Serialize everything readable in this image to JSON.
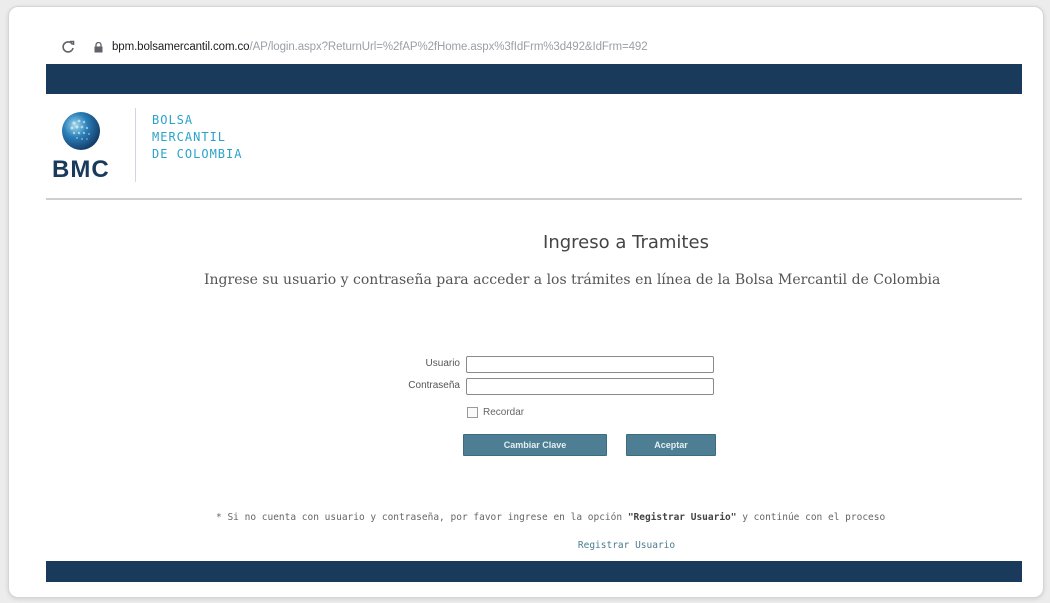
{
  "browser": {
    "url_domain": "bpm.bolsamercantil.com.co",
    "url_path": "/AP/login.aspx?ReturnUrl=%2fAP%2fHome.aspx%3fIdFrm%3d492&IdFrm=492"
  },
  "brand": {
    "logo_abbr": "BMC",
    "name_line1": "BOLSA",
    "name_line2": "MERCANTIL",
    "name_line3": "DE COLOMBIA"
  },
  "login": {
    "title": "Ingreso a Tramites",
    "subtitle": "Ingrese su usuario y contraseña para acceder a los trámites en línea de la Bolsa Mercantil de Colombia",
    "username_label": "Usuario",
    "username_value": "",
    "password_label": "Contraseña",
    "password_value": "",
    "remember_label": "Recordar",
    "change_password_button": "Cambiar Clave",
    "accept_button": "Aceptar"
  },
  "footer_note": {
    "prefix": "* Si no cuenta con usuario y contraseña, por favor ingrese en la opción ",
    "highlight": "\"Registrar Usuario\"",
    "suffix": " y continúe con el proceso",
    "register_link": "Registrar Usuario"
  },
  "colors": {
    "navy": "#1a3a5c",
    "brand_cyan": "#2aa3c9",
    "button": "#4d7e94"
  }
}
